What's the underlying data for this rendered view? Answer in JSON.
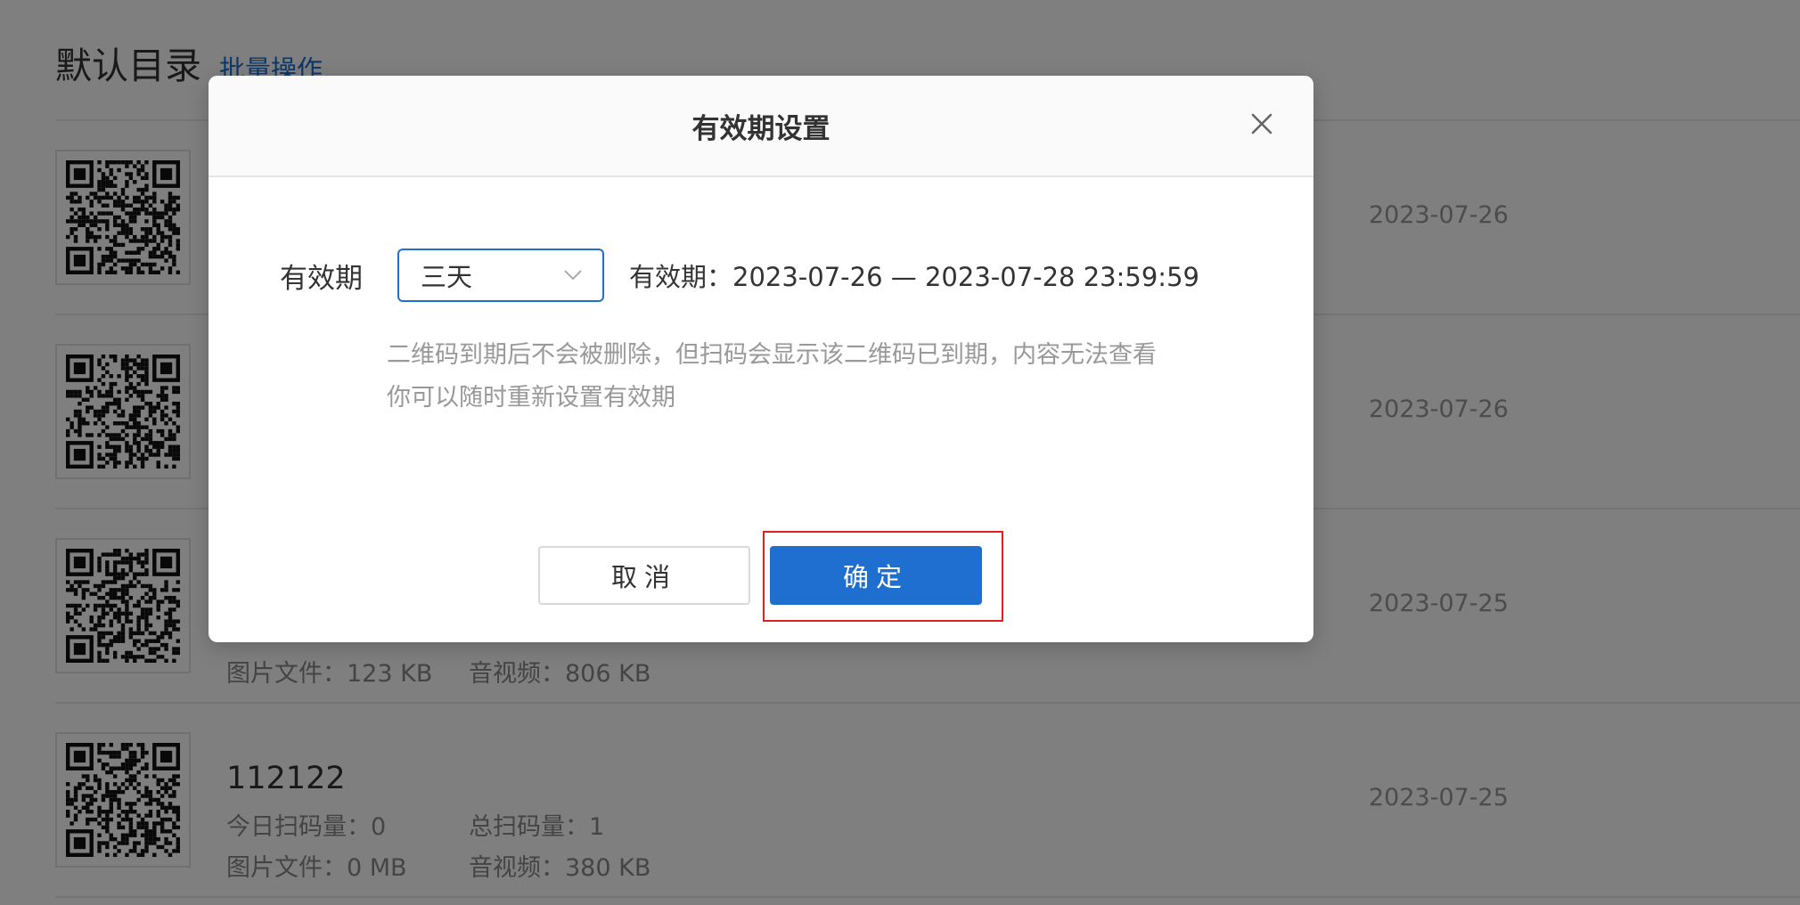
{
  "page": {
    "title": "默认目录",
    "batch_label": "批量操作"
  },
  "items": [
    {
      "name": "",
      "today_label": "",
      "total_label": "",
      "image_label": "",
      "av_label": "",
      "date": "2023-07-26"
    },
    {
      "name": "",
      "today_label": "",
      "total_label": "",
      "image_label": "",
      "av_label": "",
      "date": "2023-07-26"
    },
    {
      "name": "",
      "today_label": "",
      "total_label": "",
      "image_label": "图片文件：123 KB",
      "av_label": "音视频：806 KB",
      "date": "2023-07-25"
    },
    {
      "name": "112122",
      "today_label": "今日扫码量：0",
      "total_label": "总扫码量：1",
      "image_label": "图片文件：0 MB",
      "av_label": "音视频：380 KB",
      "date": "2023-07-25"
    }
  ],
  "modal": {
    "title": "有效期设置",
    "field_label": "有效期",
    "select_value": "三天",
    "range_text": "有效期：2023-07-26 — 2023-07-28 23:59:59",
    "note1": "二维码到期后不会被删除，但扫码会显示该二维码已到期，内容无法查看",
    "note2": "你可以随时重新设置有效期",
    "cancel_label": "取消",
    "confirm_label": "确定"
  },
  "colors": {
    "accent": "#1f6fd1",
    "highlight": "#e0201b"
  },
  "icons": {
    "close": "close-icon",
    "dropdown": "chevron-down-icon",
    "qr": "qr-code-icon"
  }
}
